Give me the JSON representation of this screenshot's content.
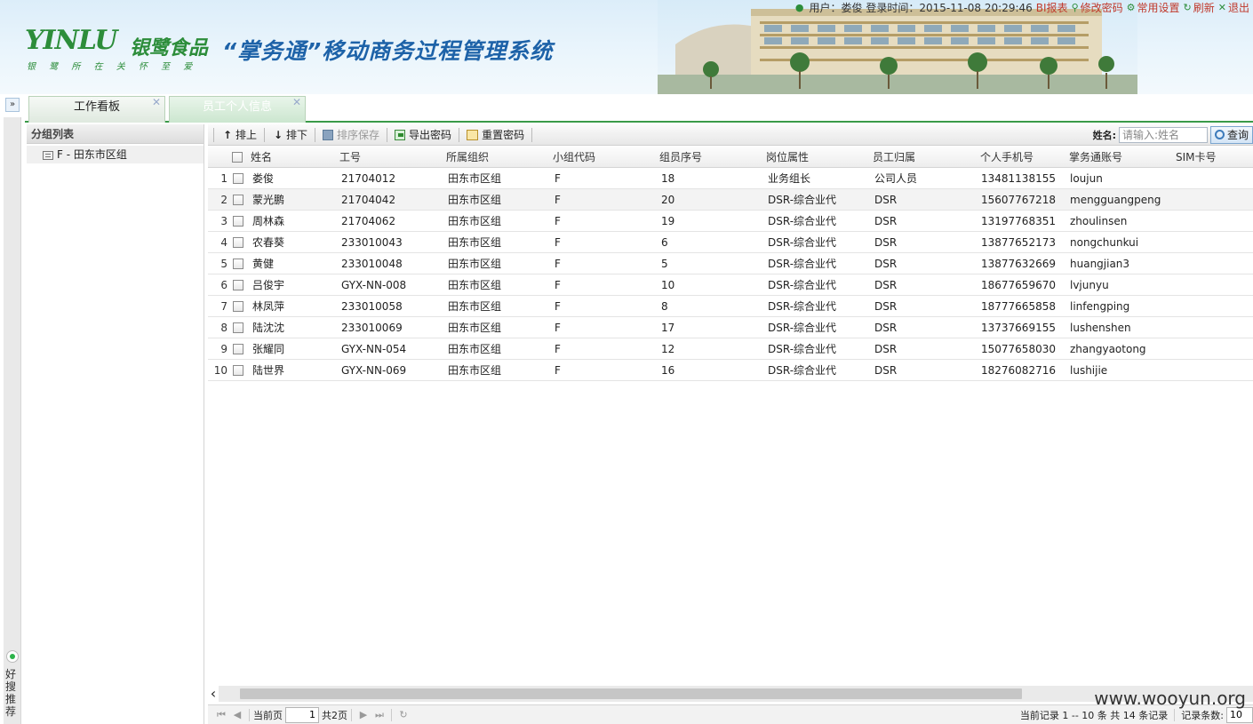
{
  "header": {
    "logo_mark": "YINLU",
    "logo_cn": "银鹭食品",
    "logo_slogan": "银 鹭 所 在  关 怀 至 爱",
    "system_title": "“掌务通”移动商务过程管理系统",
    "user_info": "用户：娄俊 登录时间：2015-11-08 20:29:46",
    "links": {
      "bi_report": "BI报表",
      "change_password": "修改密码",
      "settings": "常用设置",
      "refresh": "刷新",
      "logout": "退出"
    }
  },
  "tabs": [
    {
      "label": "工作看板"
    },
    {
      "label": "员工个人信息"
    }
  ],
  "group_panel": {
    "title": "分组列表",
    "node": "F - 田东市区组"
  },
  "toolbar": {
    "move_up": "排上",
    "move_down": "排下",
    "save_order": "排序保存",
    "export_password": "导出密码",
    "reset_password": "重置密码",
    "search_label": "姓名:",
    "search_placeholder": "请输入:姓名",
    "query": "查询"
  },
  "grid": {
    "columns": [
      "姓名",
      "工号",
      "所属组织",
      "小组代码",
      "组员序号",
      "岗位属性",
      "员工归属",
      "个人手机号",
      "掌务通账号",
      "SIM卡号"
    ],
    "rows": [
      {
        "num": "1",
        "name": "娄俊",
        "id": "21704012",
        "org": "田东市区组",
        "code": "F",
        "seq": "18",
        "pos": "业务组长",
        "belong": "公司人员",
        "phone": "13481138155",
        "acct": "loujun",
        "sim": ""
      },
      {
        "num": "2",
        "name": "蒙光鹏",
        "id": "21704042",
        "org": "田东市区组",
        "code": "F",
        "seq": "20",
        "pos": "DSR-综合业代",
        "belong": "DSR",
        "phone": "15607767218",
        "acct": "mengguangpeng",
        "sim": ""
      },
      {
        "num": "3",
        "name": "周林森",
        "id": "21704062",
        "org": "田东市区组",
        "code": "F",
        "seq": "19",
        "pos": "DSR-综合业代",
        "belong": "DSR",
        "phone": "13197768351",
        "acct": "zhoulinsen",
        "sim": ""
      },
      {
        "num": "4",
        "name": "农春葵",
        "id": "233010043",
        "org": "田东市区组",
        "code": "F",
        "seq": "6",
        "pos": "DSR-综合业代",
        "belong": "DSR",
        "phone": "13877652173",
        "acct": "nongchunkui",
        "sim": ""
      },
      {
        "num": "5",
        "name": "黄健",
        "id": "233010048",
        "org": "田东市区组",
        "code": "F",
        "seq": "5",
        "pos": "DSR-综合业代",
        "belong": "DSR",
        "phone": "13877632669",
        "acct": "huangjian3",
        "sim": ""
      },
      {
        "num": "6",
        "name": "吕俊宇",
        "id": "GYX-NN-008",
        "org": "田东市区组",
        "code": "F",
        "seq": "10",
        "pos": "DSR-综合业代",
        "belong": "DSR",
        "phone": "18677659670",
        "acct": "lvjunyu",
        "sim": ""
      },
      {
        "num": "7",
        "name": "林凤萍",
        "id": "233010058",
        "org": "田东市区组",
        "code": "F",
        "seq": "8",
        "pos": "DSR-综合业代",
        "belong": "DSR",
        "phone": "18777665858",
        "acct": "linfengping",
        "sim": ""
      },
      {
        "num": "8",
        "name": "陆沈沈",
        "id": "233010069",
        "org": "田东市区组",
        "code": "F",
        "seq": "17",
        "pos": "DSR-综合业代",
        "belong": "DSR",
        "phone": "13737669155",
        "acct": "lushenshen",
        "sim": ""
      },
      {
        "num": "9",
        "name": "张耀同",
        "id": "GYX-NN-054",
        "org": "田东市区组",
        "code": "F",
        "seq": "12",
        "pos": "DSR-综合业代",
        "belong": "DSR",
        "phone": "15077658030",
        "acct": "zhangyaotong",
        "sim": ""
      },
      {
        "num": "10",
        "name": "陆世界",
        "id": "GYX-NN-069",
        "org": "田东市区组",
        "code": "F",
        "seq": "16",
        "pos": "DSR-综合业代",
        "belong": "DSR",
        "phone": "18276082716",
        "acct": "lushijie",
        "sim": ""
      }
    ]
  },
  "pager": {
    "current_label": "当前页",
    "current_page": "1",
    "total_pages": "共2页",
    "records_info": "当前记录 1 -- 10 条  共 14 条记录",
    "page_size_label": "记录条数:",
    "page_size": "10"
  },
  "sidebar_recommend": "好搜推荐",
  "watermark": "www.wooyun.org",
  "colors": {
    "accent_green": "#2c8d3a",
    "title_blue": "#1d62a8",
    "link_red": "#c0392b"
  }
}
